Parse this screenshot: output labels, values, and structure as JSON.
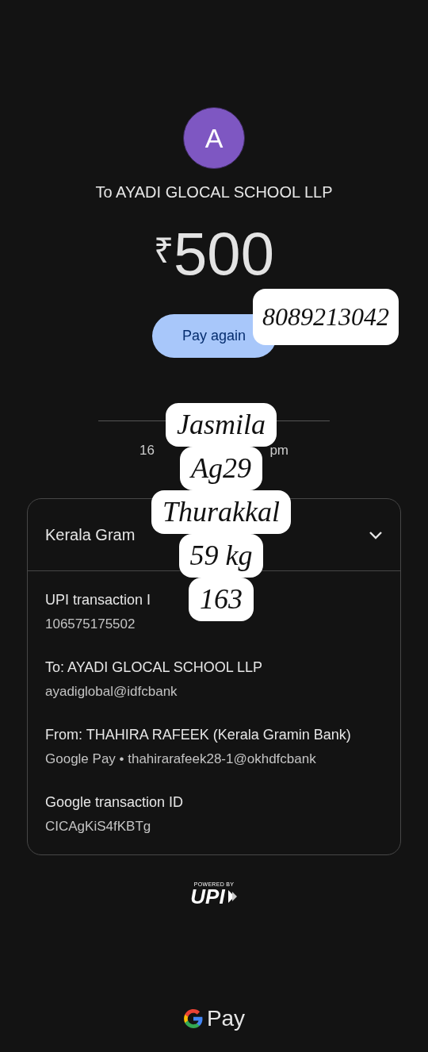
{
  "recipient": {
    "avatar_letter": "A",
    "title": "To AYADI GLOCAL SCHOOL LLP"
  },
  "amount": {
    "currency": "₹",
    "value": "500"
  },
  "pay_again_button": "Pay again",
  "date_fragments": [
    "16",
    "pm"
  ],
  "details_card": {
    "bank": "Kerala Gram",
    "rows": [
      {
        "label": "UPI transaction I",
        "value": "106575175502"
      },
      {
        "label": "To: AYADI GLOCAL SCHOOL LLP",
        "value": "ayadiglobal@idfcbank"
      },
      {
        "label": "From: THAHIRA RAFEEK (Kerala Gramin Bank)",
        "value": "Google Pay • thahirarafeek28-1@okhdfcbank"
      },
      {
        "label": "Google transaction ID",
        "value": "CICAgKiS4fKBTg"
      }
    ]
  },
  "powered_by": {
    "caption": "POWERED BY",
    "brand": "UPI"
  },
  "footer": {
    "brand": "Pay"
  },
  "stickers": [
    {
      "lines": [
        "8089213042"
      ]
    },
    {
      "lines": [
        "Jasmila",
        "Ag29",
        "Thurakkal",
        "59 kg",
        "163"
      ]
    }
  ]
}
